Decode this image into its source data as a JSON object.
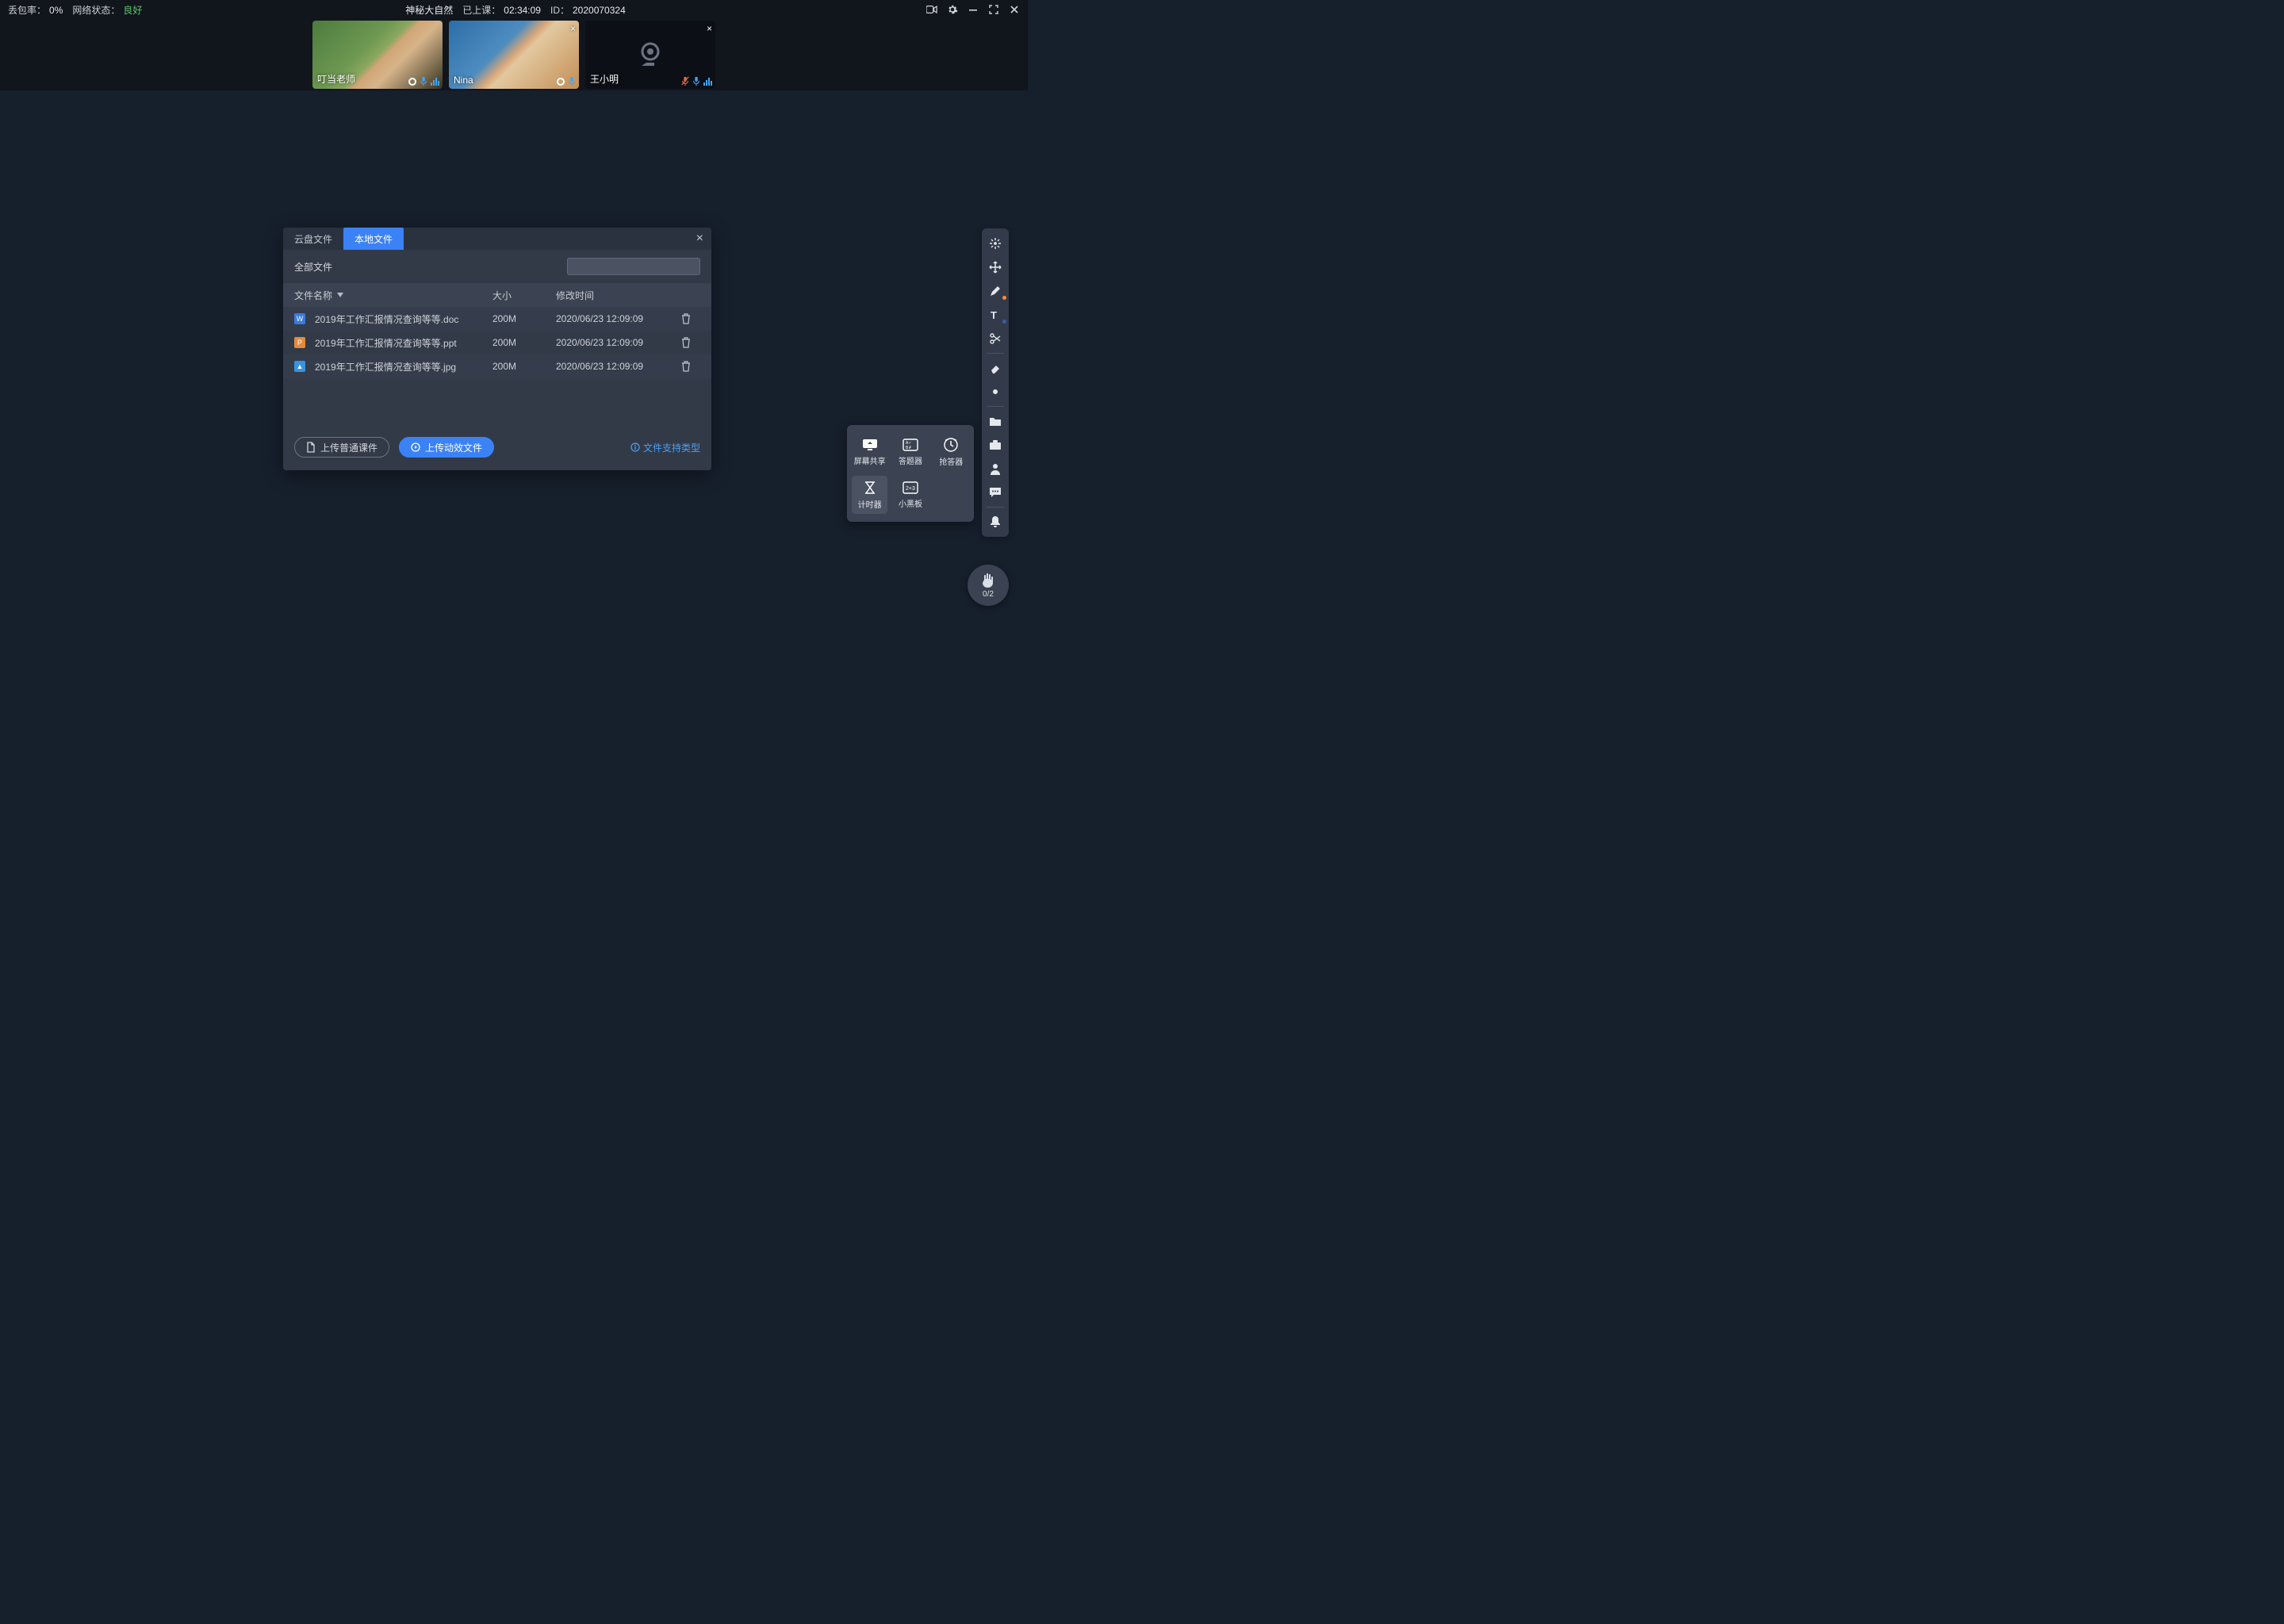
{
  "titlebar": {
    "loss_label": "丢包率：",
    "loss_value": "0%",
    "net_label": "网络状态：",
    "net_value": "良好",
    "course": "神秘大自然",
    "elapsed_label": "已上课：",
    "elapsed_value": "02:34:09",
    "id_label": "ID：",
    "id_value": "2020070324"
  },
  "participants": [
    {
      "name": "叮当老师",
      "camera_off": false,
      "mic_muted": false,
      "closable": false
    },
    {
      "name": "Nina",
      "camera_off": false,
      "mic_muted": false,
      "closable": true
    },
    {
      "name": "王小明",
      "camera_off": true,
      "mic_muted": true,
      "closable": true
    }
  ],
  "modal": {
    "tabs": [
      "云盘文件",
      "本地文件"
    ],
    "active_tab": 1,
    "all_files_label": "全部文件",
    "search_placeholder": "",
    "columns": {
      "name": "文件名称",
      "size": "大小",
      "time": "修改时间"
    },
    "rows": [
      {
        "icon": "W",
        "name": "2019年工作汇报情况查询等等.doc",
        "size": "200M",
        "time": "2020/06/23 12:09:09"
      },
      {
        "icon": "P",
        "name": "2019年工作汇报情况查询等等.ppt",
        "size": "200M",
        "time": "2020/06/23 12:09:09"
      },
      {
        "icon": "I",
        "name": "2019年工作汇报情况查询等等.jpg",
        "size": "200M",
        "time": "2020/06/23 12:09:09"
      }
    ],
    "btn_upload_normal": "上传普通课件",
    "btn_upload_anim": "上传动效文件",
    "support_link": "文件支持类型"
  },
  "popover": {
    "screen_share": "屏幕共享",
    "answerer": "答题器",
    "responder": "抢答器",
    "timer": "计时器",
    "small_board": "小黑板"
  },
  "hand": {
    "count": "0/2"
  },
  "toolbar_items": [
    "laser-icon",
    "move-icon",
    "pen-icon",
    "text-icon",
    "scissors-icon",
    "eraser-icon",
    "dot-tool-icon",
    "folder-icon",
    "toolbox-icon",
    "person-icon",
    "chat-icon",
    "bell-icon"
  ]
}
